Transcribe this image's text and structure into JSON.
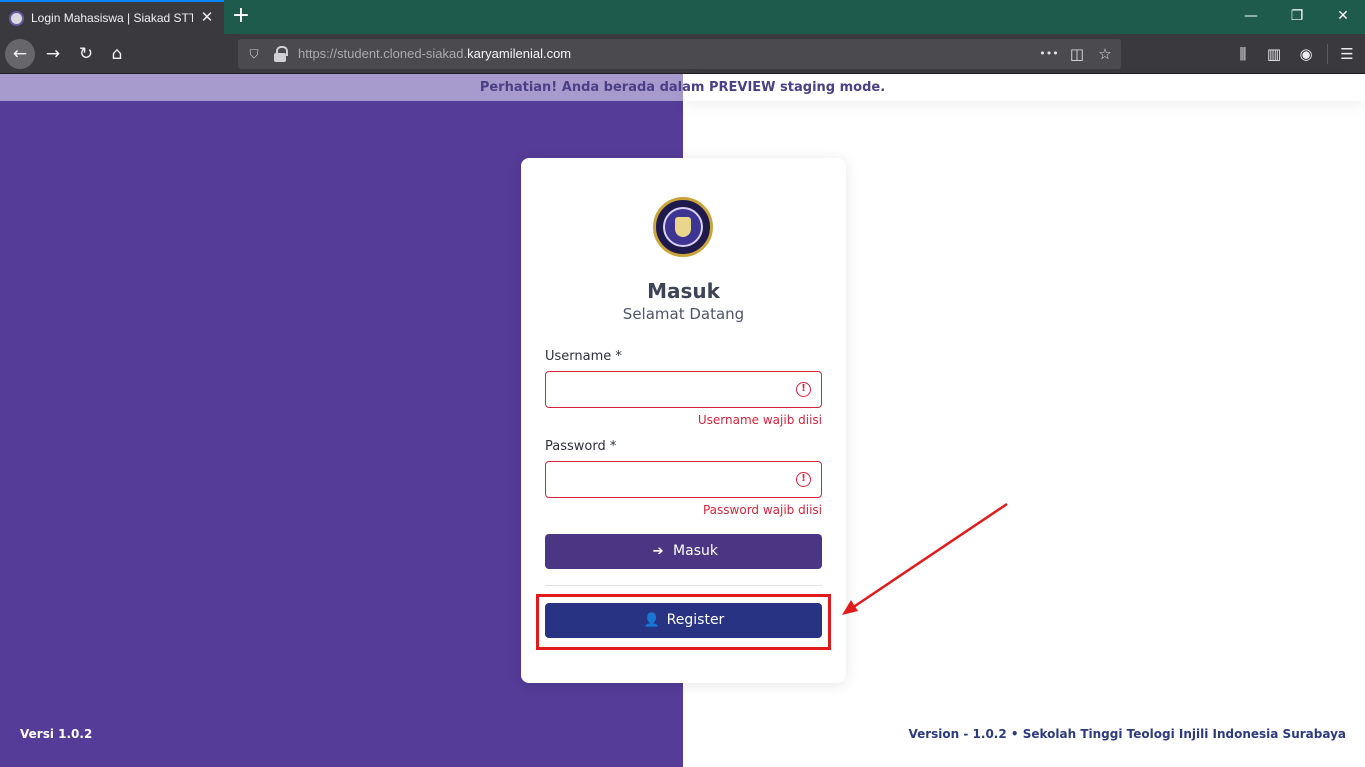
{
  "browser": {
    "tab_title": "Login Mahasiswa | Siakad STTII",
    "tab_close": "✕",
    "new_tab": "+",
    "url_dim": "https://student.cloned-siakad.",
    "url_host": "karyamilenial.com",
    "window_controls": {
      "minimize": "—",
      "restore": "❐",
      "close": "✕"
    },
    "nav": {
      "back": "←",
      "forward": "→",
      "reload": "↻",
      "home": "⌂"
    },
    "url_actions": {
      "more": "•••",
      "pocket": "◫",
      "bookmark": "☆"
    },
    "tools": {
      "library": "⫼",
      "sidebar": "▥",
      "account": "◉",
      "menu": "☰"
    },
    "shield": "⛉"
  },
  "preview_banner": "Perhatian! Anda berada dalam PREVIEW staging mode.",
  "login": {
    "title": "Masuk",
    "subtitle": "Selamat Datang",
    "username_label": "Username *",
    "username_value": "",
    "username_error": "Username wajib diisi",
    "password_label": "Password *",
    "password_value": "",
    "password_error": "Password wajib diisi",
    "error_icon": "!",
    "login_button": "Masuk",
    "login_icon": "➔",
    "register_button": "Register",
    "register_icon": "👤"
  },
  "footer": {
    "left": "Versi 1.0.2",
    "right": "Version - 1.0.2  •  Sekolah Tinggi Teologi Injili Indonesia Surabaya"
  },
  "colors": {
    "primary_purple": "#543c98",
    "login_button": "#4a3682",
    "register_button": "#283383",
    "error": "#d6243c",
    "annotation": "#e01b1b"
  }
}
